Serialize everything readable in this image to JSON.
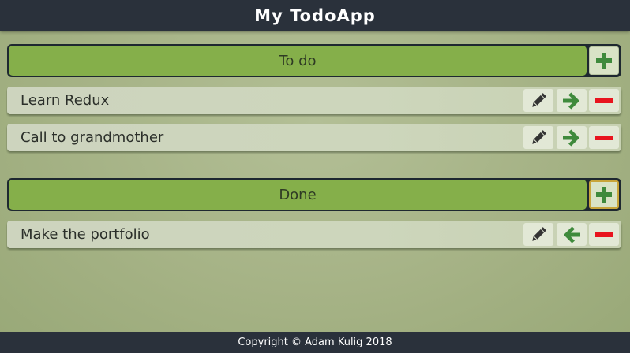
{
  "app": {
    "title": "My TodoApp"
  },
  "sections": [
    {
      "title": "To do",
      "add_icon": "plus-icon",
      "items": [
        {
          "label": "Learn Redux",
          "move_icon": "arrow-right-icon"
        },
        {
          "label": "Call to grandmother",
          "move_icon": "arrow-right-icon"
        }
      ]
    },
    {
      "title": "Done",
      "add_icon": "plus-icon",
      "items": [
        {
          "label": "Make the portfolio",
          "move_icon": "arrow-left-icon"
        }
      ]
    }
  ],
  "icons": {
    "edit": "pencil-icon",
    "delete": "minus-icon"
  },
  "colors": {
    "header_bg": "#2a313b",
    "section_bar": "#85af4a",
    "icon_green": "#3f8a3c",
    "icon_red": "#e8141e"
  },
  "footer": {
    "text": "Copyright © Adam Kulig 2018"
  }
}
